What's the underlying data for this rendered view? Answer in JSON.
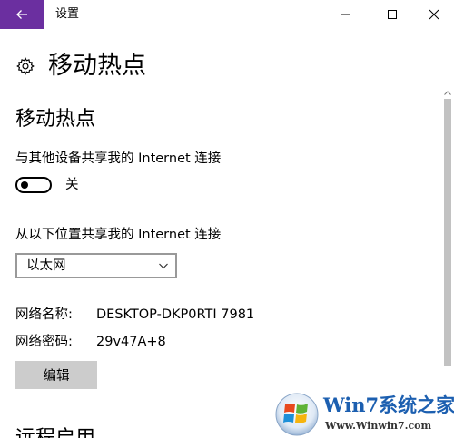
{
  "window": {
    "title": "设置"
  },
  "header": {
    "title": "移动热点"
  },
  "hotspot": {
    "section_title": "移动热点",
    "share_label": "与其他设备共享我的 Internet 连接",
    "toggle_state": "关",
    "toggle_on": false,
    "from_label": "从以下位置共享我的 Internet 连接",
    "source_selected": "以太网",
    "network_name_label": "网络名称:",
    "network_name_value": "DESKTOP-DKP0RTI 7981",
    "password_label": "网络密码:",
    "password_value": "29v47A+8",
    "edit_label": "编辑"
  },
  "next_section": {
    "title": "远程启用"
  },
  "watermark": {
    "brand": "Win7系统之家",
    "url": "Www.Winwin7.com"
  },
  "colors": {
    "accent": "#6b2fa0",
    "scroll_thumb": "#c2c2c2",
    "button_bg": "#cccccc",
    "watermark_blue": "#1c5fb0"
  },
  "icons": {
    "back": "arrow-left-icon",
    "minimize": "minimize-icon",
    "maximize": "maximize-icon",
    "close": "close-icon",
    "settings": "gear-icon",
    "dropdown": "chevron-down-icon",
    "scroll_up": "scroll-up-arrow-icon"
  }
}
